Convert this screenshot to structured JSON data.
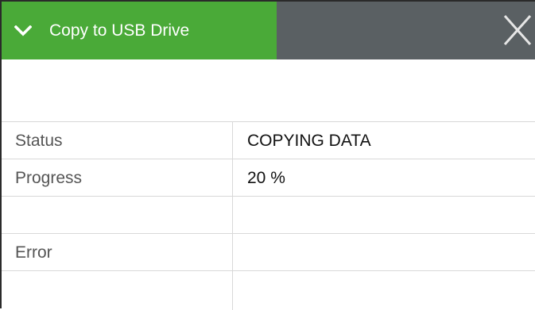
{
  "dialog": {
    "title": "Copy to USB Drive",
    "collapse_icon": "chevron-down-icon",
    "close_icon": "close-icon",
    "accent_color": "#4aaa38",
    "header_color": "#5a6063"
  },
  "status_table": {
    "rows": [
      {
        "label": "Status",
        "value": "COPYING DATA"
      },
      {
        "label": "Progress",
        "value": "20 %"
      },
      {
        "label": "",
        "value": ""
      },
      {
        "label": "Error",
        "value": ""
      },
      {
        "label": "",
        "value": ""
      }
    ]
  }
}
